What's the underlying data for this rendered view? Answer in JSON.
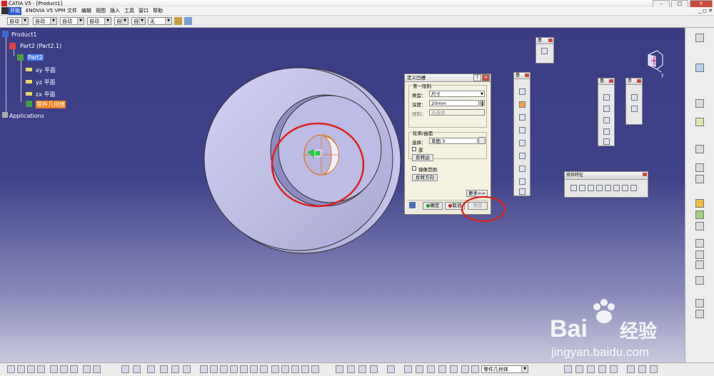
{
  "window": {
    "title": "CATIA V5 - [Product1]"
  },
  "menu": [
    {
      "label": "开始",
      "active": true
    },
    {
      "label": "ENOVIA V5 VPM",
      "active": false
    },
    {
      "label": "文件",
      "active": false
    },
    {
      "label": "编辑",
      "active": false
    },
    {
      "label": "视图",
      "active": false
    },
    {
      "label": "插入",
      "active": false
    },
    {
      "label": "工具",
      "active": false
    },
    {
      "label": "窗口",
      "active": false
    },
    {
      "label": "帮助",
      "active": false
    }
  ],
  "property_bar": {
    "combos": [
      "自动",
      "自动",
      "自动",
      "自动",
      "自动",
      "自动",
      "无"
    ]
  },
  "tree": {
    "root": "Product1",
    "part_instance": "Part2 (Part2.1)",
    "part": "Part2",
    "planes": [
      "xy 平面",
      "yz 平面",
      "zx 平面"
    ],
    "body": "零件几何体",
    "applications": "Applications"
  },
  "dialog": {
    "title": "定义凹槽",
    "help_btn": "?",
    "first_limit_label": "第一限制",
    "type_label": "类型：",
    "type_value": "尺寸",
    "depth_label": "深度：",
    "depth_value": "20mm",
    "limit_label": "限制：",
    "limit_value": "无选择",
    "profile_group_label": "轮廓/曲面",
    "select_label": "选择：",
    "select_value": "草图.3",
    "thick_label": "厚",
    "reverse_side_btn": "反转边",
    "mirror_label": "镜像范围",
    "reverse_dir_btn": "反转方向",
    "more_btn": "更多>>",
    "ok_btn": "确定",
    "cancel_btn": "取消",
    "preview_btn": "预览"
  },
  "floating_toolbars": {
    "top_small": "基",
    "tall_left": "基",
    "mid": "基",
    "right_small": "参",
    "dress_up": "修饰特征"
  },
  "status_combo": "零件几何体",
  "watermark": {
    "brand": "Bai",
    "brand2": "经验",
    "url": "jingyan.baidu.com"
  },
  "compass_label": "y",
  "colors": {
    "highlight_red": "#e0201e",
    "sketch_orange": "#f08020",
    "model_face": "#bdbce6"
  }
}
